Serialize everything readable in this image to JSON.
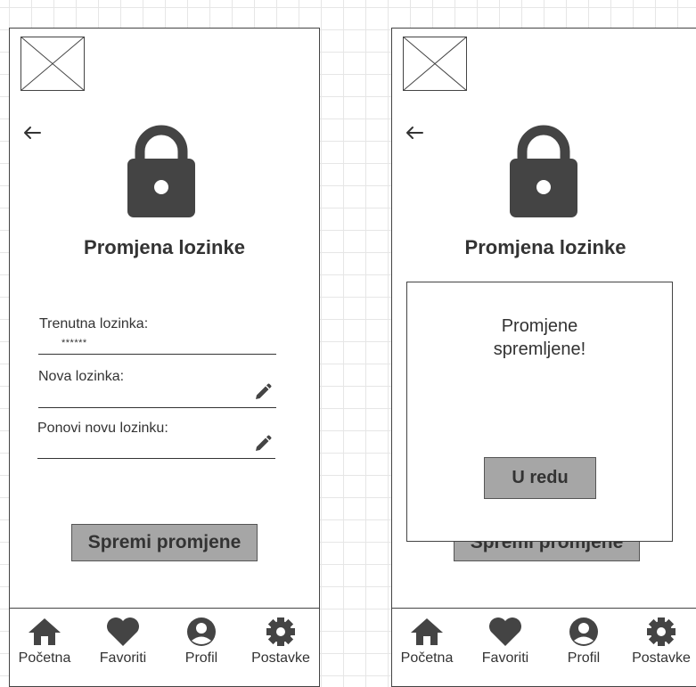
{
  "screen_before": {
    "title": "Promjena lozinke",
    "fields": [
      {
        "label": "Trenutna lozinka:",
        "value": "******"
      },
      {
        "label": "Nova lozinka:",
        "value": ""
      },
      {
        "label": "Ponovi novu lozinku:",
        "value": ""
      }
    ],
    "save_label": "Spremi promjene"
  },
  "screen_after": {
    "title": "Promjena lozinke",
    "save_label": "Spremi promjene",
    "dialog": {
      "line1": "Promjene",
      "line2": "spremljene!",
      "ok_label": "U redu"
    }
  },
  "nav": [
    {
      "label": "Početna",
      "icon": "home-icon"
    },
    {
      "label": "Favoriti",
      "icon": "heart-icon"
    },
    {
      "label": "Profil",
      "icon": "profile-icon"
    },
    {
      "label": "Postavke",
      "icon": "gear-icon"
    }
  ],
  "colors": {
    "icon": "#444444",
    "button_bg": "#a6a6a6",
    "border": "#444444"
  }
}
